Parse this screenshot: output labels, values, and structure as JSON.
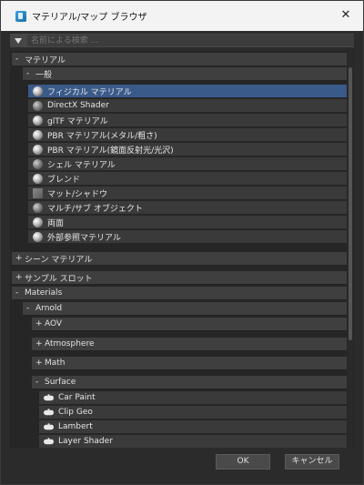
{
  "window": {
    "title": "マテリアル/マップ ブラウザ",
    "close_glyph": "✕"
  },
  "search": {
    "value": "",
    "placeholder": "名前による検索 ..."
  },
  "tree": {
    "materials_group": {
      "sign": "-",
      "label": "マテリアル"
    },
    "general_group": {
      "sign": "-",
      "label": "一般"
    },
    "general_items": [
      "フィジカル マテリアル",
      "DirectX Shader",
      "glTF マテリアル",
      "PBR マテリアル(メタル/粗さ)",
      "PBR マテリアル(鏡面反射光/光沢)",
      "シェル マテリアル",
      "ブレンド",
      "マット/シャドウ",
      "マルチ/サブ オブジェクト",
      "両面",
      "外部参照マテリアル"
    ],
    "scene_materials": {
      "sign": "+",
      "label": "シーン マテリアル"
    },
    "sample_slots": {
      "sign": "+",
      "label": "サンプル スロット"
    },
    "materials_en": {
      "sign": "-",
      "label": "Materials"
    },
    "arnold": {
      "sign": "-",
      "label": "Arnold"
    },
    "aov": {
      "sign": "+",
      "label": "AOV"
    },
    "atmosphere": {
      "sign": "+",
      "label": "Atmosphere"
    },
    "math": {
      "sign": "+",
      "label": "Math"
    },
    "surface": {
      "sign": "-",
      "label": "Surface"
    },
    "surface_items": [
      "Car Paint",
      "Clip Geo",
      "Lambert",
      "Layer Shader"
    ]
  },
  "buttons": {
    "ok": "OK",
    "cancel": "キャンセル"
  },
  "colors": {
    "selection": "#3a5a8a",
    "titlebar": "#f3f3f3",
    "background": "#2b2b2b"
  }
}
